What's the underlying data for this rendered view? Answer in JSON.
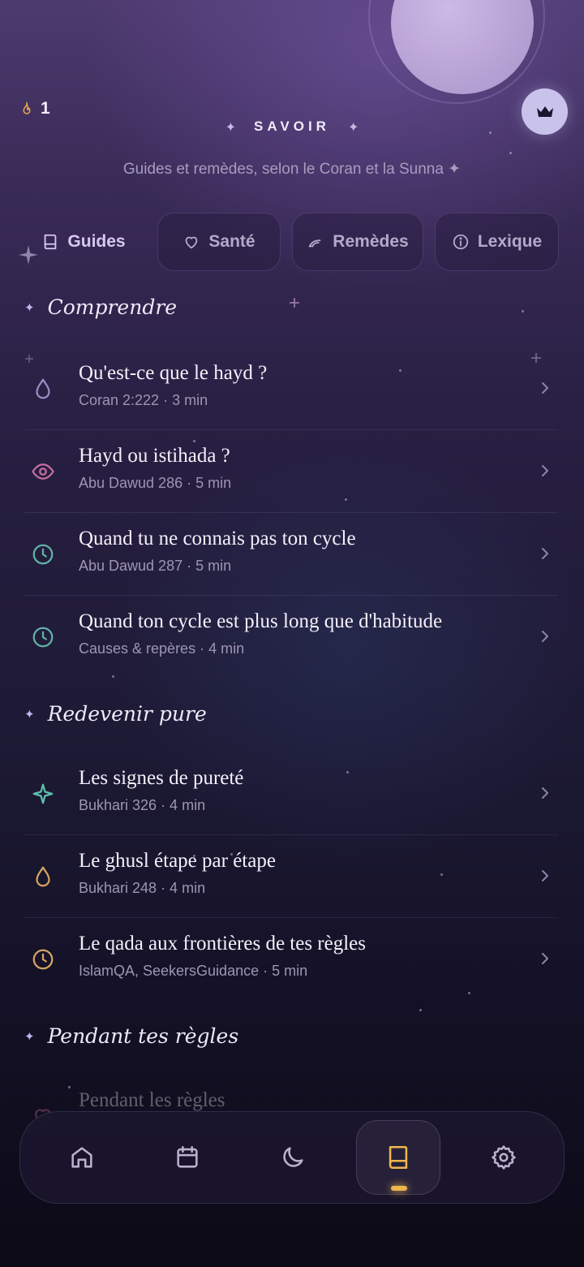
{
  "header": {
    "streak_count": "1",
    "title": "SAVOIR",
    "title_spark": "✦",
    "subtitle": "Guides et remèdes, selon le Coran et la Sunna ✦"
  },
  "tabs": [
    {
      "label": "Guides",
      "icon": "book-icon",
      "active": true
    },
    {
      "label": "Santé",
      "icon": "heart-icon",
      "active": false
    },
    {
      "label": "Remèdes",
      "icon": "leaf-icon",
      "active": false
    },
    {
      "label": "Lexique",
      "icon": "info-icon",
      "active": false
    }
  ],
  "sections": [
    {
      "title": "Comprendre",
      "spark": "✦",
      "items": [
        {
          "title": "Qu'est-ce que le hayd ?",
          "subtitle": "Coran 2:222 · 3 min",
          "icon": "drop-icon",
          "color": "#9a8cc4"
        },
        {
          "title": "Hayd ou istihada ?",
          "subtitle": "Abu Dawud 286 · 5 min",
          "icon": "eye-icon",
          "color": "#c86f9e"
        },
        {
          "title": "Quand tu ne connais pas ton cycle",
          "subtitle": "Abu Dawud 287 · 5 min",
          "icon": "clock-icon",
          "color": "#5fb3a6"
        },
        {
          "title": "Quand ton cycle est plus long que d'habitude",
          "subtitle": "Causes & repères · 4 min",
          "icon": "clock-icon",
          "color": "#5fb3a6"
        }
      ]
    },
    {
      "title": "Redevenir pure",
      "spark": "✦",
      "items": [
        {
          "title": "Les signes de pureté",
          "subtitle": "Bukhari 326 · 4 min",
          "icon": "sparkle-icon",
          "color": "#5fc0ac"
        },
        {
          "title": "Le ghusl étape par étape",
          "subtitle": "Bukhari 248 · 4 min",
          "icon": "drop-icon",
          "color": "#d3a45f"
        },
        {
          "title": "Le qada aux frontières de tes règles",
          "subtitle": "IslamQA, SeekersGuidance · 5 min",
          "icon": "clock-icon",
          "color": "#d3a45f"
        }
      ]
    },
    {
      "title": "Pendant tes règles",
      "spark": "✦",
      "items": [
        {
          "title": "Pendant les règles",
          "subtitle": "",
          "icon": "heart-icon",
          "color": "#c86f9e"
        }
      ]
    }
  ],
  "nav": [
    {
      "name": "home",
      "icon": "home-icon",
      "active": false
    },
    {
      "name": "calendar",
      "icon": "calendar-icon",
      "active": false
    },
    {
      "name": "moon",
      "icon": "moon-icon",
      "active": false
    },
    {
      "name": "knowledge",
      "icon": "book-icon",
      "active": true
    },
    {
      "name": "settings",
      "icon": "gear-icon",
      "active": false
    }
  ],
  "colors": {
    "accent": "#f0b64e",
    "active_tab": "#d6c8f1",
    "premium_button": "#c9c3ec"
  }
}
